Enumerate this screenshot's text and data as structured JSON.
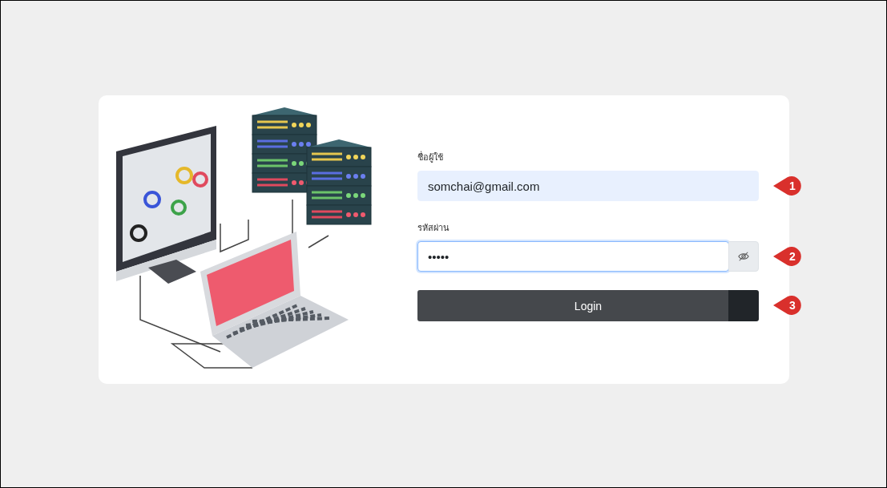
{
  "login_form": {
    "username": {
      "label": "ชื่อผู้ใช้",
      "value": "somchai@gmail.com",
      "callout": "1"
    },
    "password": {
      "label": "รหัสผ่าน",
      "value": "•••••",
      "focused": true,
      "callout": "2"
    },
    "login_button": {
      "label": "Login",
      "callout": "3"
    }
  }
}
